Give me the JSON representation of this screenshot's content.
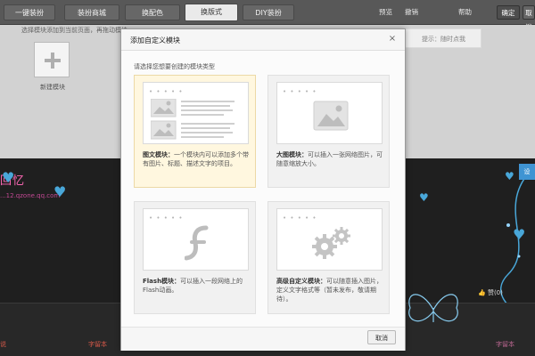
{
  "toolbar": {
    "tabs": [
      {
        "label": "一键装扮"
      },
      {
        "label": "装扮商城"
      },
      {
        "label": "换配色"
      },
      {
        "label": "换版式"
      },
      {
        "label": "DIY装扮"
      }
    ],
    "active_tab": "换版式",
    "right_links": [
      "预览",
      "撤销",
      "帮助"
    ],
    "save_label": "确定",
    "cancel_label": "取消"
  },
  "editor": {
    "tip": "选择模块添加到当前页面，再拖动模块",
    "new_module_label": "新建模块",
    "notice_text": "提示：随时点我"
  },
  "background_page": {
    "blog_title": "回忆",
    "blog_url": "...12.qzone.qq.com",
    "like_count": "赞(0)",
    "side_button": "设",
    "bottom_left": "说",
    "bottom_right_1": "字留本",
    "bottom_right_2": "字留本"
  },
  "modal": {
    "title": "添加自定义模块",
    "close_symbol": "×",
    "subtitle": "请选择您想要创建的模块类型",
    "cards": [
      {
        "title": "图文模块：",
        "desc": "一个模块内可以添加多个带有图片、标题、描述文字的项目。",
        "icon": "image-text-icon"
      },
      {
        "title": "大图模块：",
        "desc": "可以插入一张网络图片，可随意缩放大小。",
        "icon": "large-image-icon"
      },
      {
        "title": "Flash模块：",
        "desc": "可以插入一段网络上的Flash动画。",
        "icon": "flash-icon"
      },
      {
        "title": "高级自定义模块：",
        "desc": "可以随意插入图片，定义文字格式等（暂未发布，敬请期待）。",
        "icon": "gear-icon"
      }
    ],
    "cancel_label": "取消"
  },
  "colors": {
    "accent_selected": "#fff7df",
    "toolbar": "#4a4a4a",
    "pink": "#ff5cb0",
    "blue": "#3aa0d6"
  }
}
